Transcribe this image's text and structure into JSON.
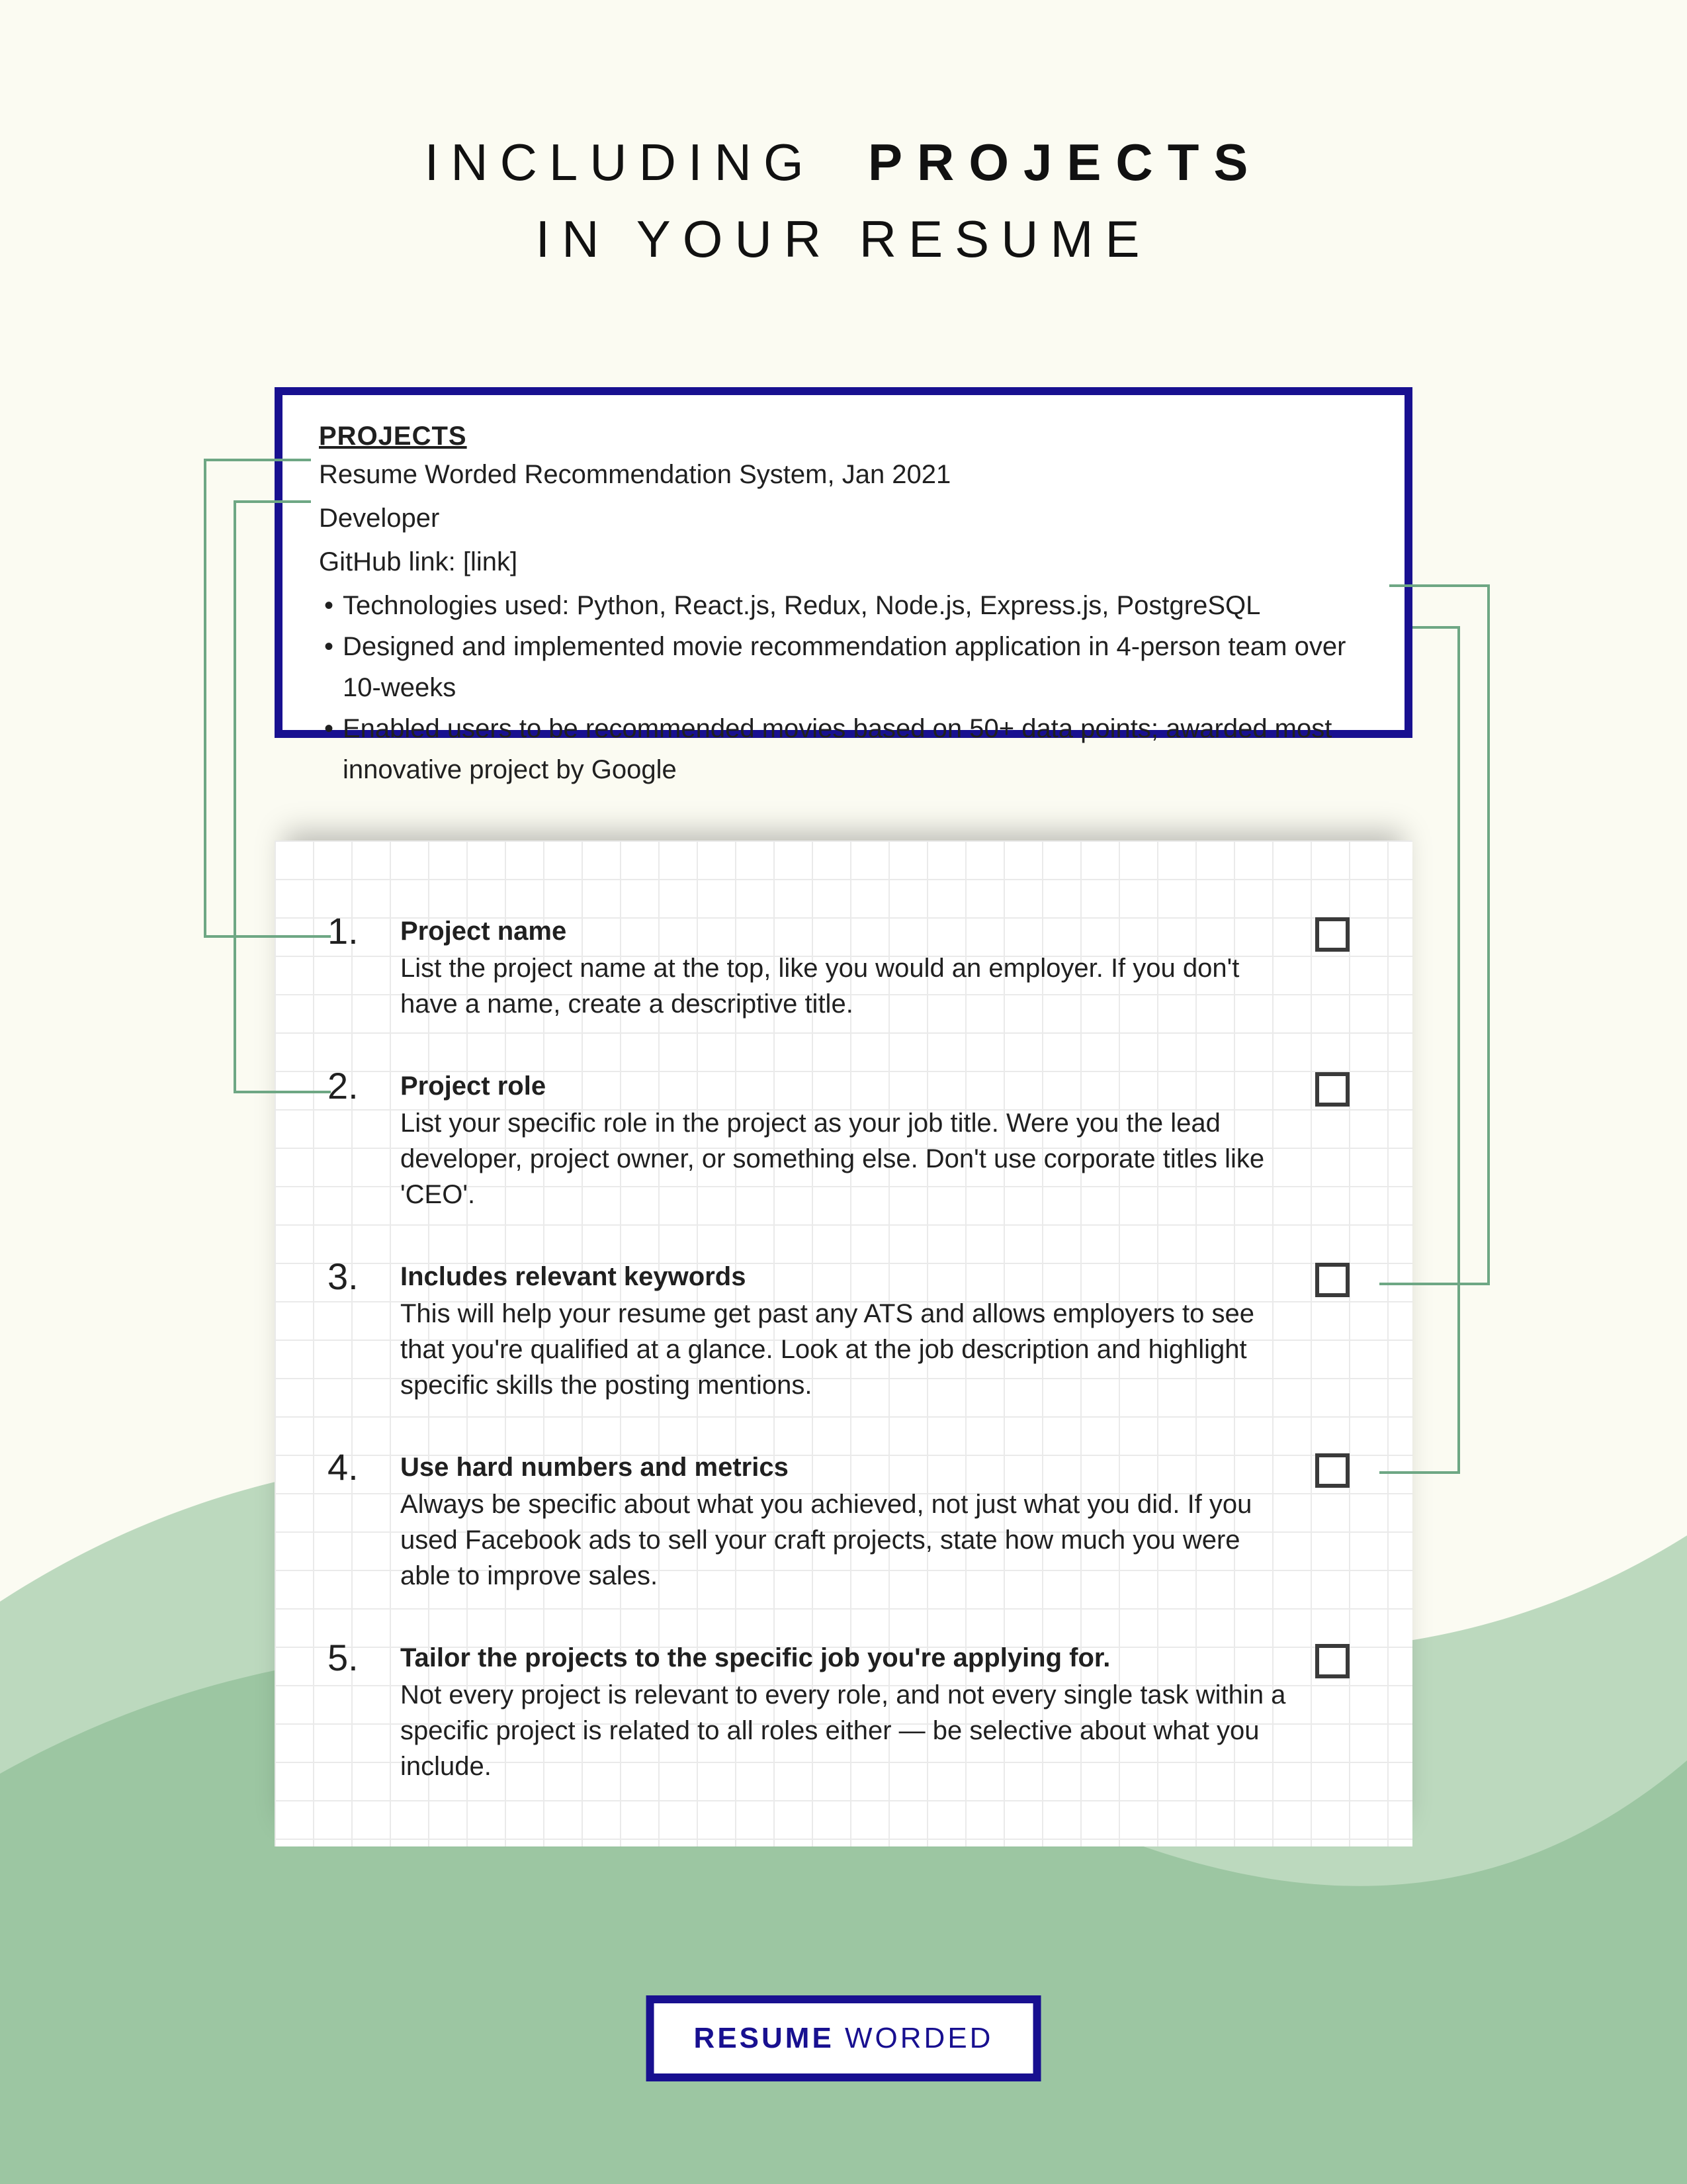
{
  "title": {
    "pre": "INCLUDING",
    "strong": "PROJECTS",
    "line2": "IN YOUR RESUME"
  },
  "projects": {
    "header": "PROJECTS",
    "line1": "Resume Worded Recommendation System, Jan 2021",
    "line2": "Developer",
    "line3": "GitHub link: [link]",
    "b1": "Technologies used: Python, React.js, Redux, Node.js, Express.js, PostgreSQL",
    "b2": "Designed and implemented movie recommendation application in 4-person team over 10-weeks",
    "b3": "Enabled users to be recommended movies based on 50+ data points; awarded most innovative project by Google"
  },
  "tips": [
    {
      "n": "1.",
      "t": "Project name",
      "d": "List the project name at the top, like you would an employer. If you don't have a name, create a descriptive title."
    },
    {
      "n": "2.",
      "t": "Project role",
      "d": "List your specific role in the project as your job title. Were you the lead developer, project owner, or something else. Don't use corporate titles like 'CEO'."
    },
    {
      "n": "3.",
      "t": "Includes relevant keywords",
      "d": "This will help your resume get past any ATS and allows employers to see that you're qualified at a glance. Look at the job description and highlight specific skills the posting mentions."
    },
    {
      "n": "4.",
      "t": "Use hard numbers and metrics",
      "d": "Always be specific about what you achieved, not just what you did. If you used Facebook ads to sell your craft projects, state how much you were able to improve sales."
    },
    {
      "n": "5.",
      "t": "Tailor the projects to the specific job you're applying for.",
      "d": "Not every project is relevant to every role, and not every single task within a specific project is related to all roles either — be selective about what you include."
    }
  ],
  "logo": {
    "a": "RESUME",
    "b": "WORDED"
  }
}
